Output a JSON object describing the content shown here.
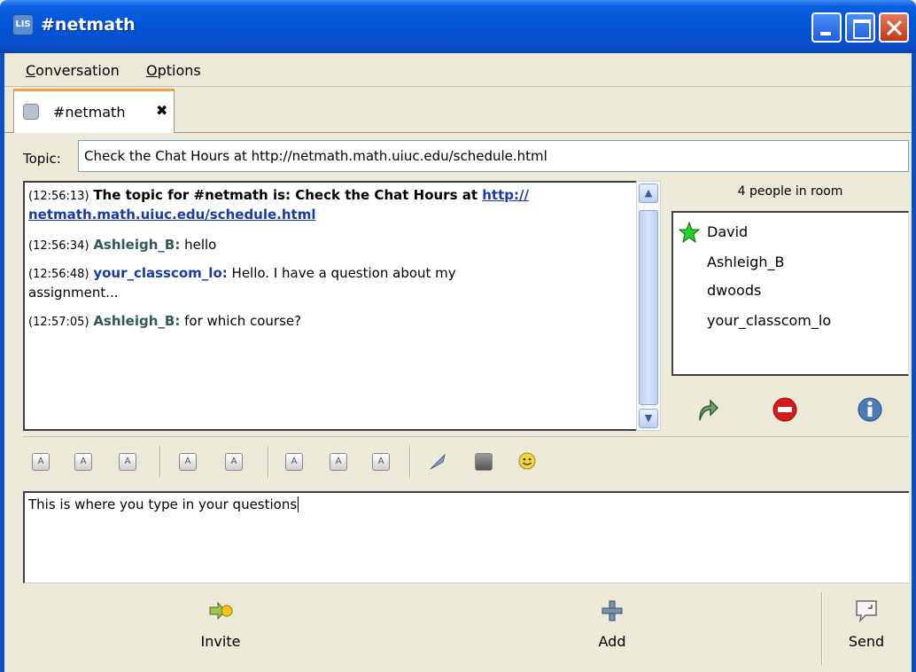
{
  "window": {
    "title": "#netmath",
    "icon_text": "LIS"
  },
  "menu": {
    "conversation": "Conversation",
    "conversation_key": "C",
    "conversation_rest": "onversation",
    "options": "Options",
    "options_key": "O",
    "options_rest": "ptions"
  },
  "tab": {
    "label": "#netmath",
    "close": "✖"
  },
  "topic": {
    "label": "Topic:",
    "value": "Check the Chat Hours at http://netmath.math.uiuc.edu/schedule.html"
  },
  "chat": {
    "m1": {
      "time": "(12:56:13)",
      "text": "The topic for #netmath is: Check the Chat Hours at ",
      "link_a": "http://",
      "link_b": "netmath.math.uiuc.edu/schedule.html"
    },
    "m2": {
      "time": "(12:56:34)",
      "user": "Ashleigh_B:",
      "text": " hello"
    },
    "m3": {
      "time": "(12:56:48)",
      "user": "your_classcom_lo:",
      "text": " Hello.  I have a question about my",
      "text2": "assignment..."
    },
    "m4": {
      "time": "(12:57:05)",
      "user": "Ashleigh_B:",
      "text": " for which course?"
    }
  },
  "people": {
    "title": "4 people in room",
    "list": [
      "David",
      "Ashleigh_B",
      "dwoods",
      "your_classcom_lo"
    ]
  },
  "input": {
    "value": "This is where you type in your questions"
  },
  "buttons": {
    "invite": "Invite",
    "add": "Add",
    "send": "Send"
  },
  "colors": {
    "titlebar": "#0454d8",
    "tab_accent": "#f2a43a",
    "username": "#2e5a5a",
    "link": "#1a3aa8"
  }
}
